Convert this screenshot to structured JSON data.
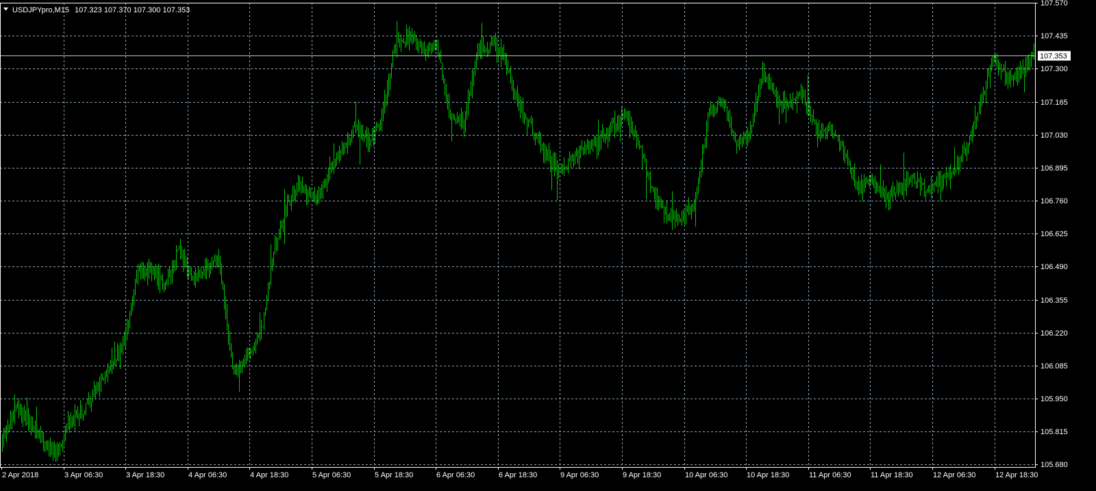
{
  "header": {
    "symbol": "USDJPYpro,M15",
    "ohlc": "107.323 107.370 107.300 107.353"
  },
  "colors": {
    "background": "#000000",
    "grid": "#8fa6b8",
    "bars": "#00c800",
    "axis_text": "#ffffff",
    "bid_line": "#c0c0c0"
  },
  "current_price": {
    "label": "107.353",
    "value": 107.353
  },
  "chart_data": {
    "type": "ohlc-bar",
    "symbol": "USDJPYpro",
    "timeframe": "M15",
    "ylim": [
      105.67,
      107.57
    ],
    "y_ticks": [
      107.57,
      107.435,
      107.3,
      107.165,
      107.03,
      106.895,
      106.76,
      106.625,
      106.49,
      106.355,
      106.22,
      106.085,
      105.95,
      105.815,
      105.68
    ],
    "y_tick_labels": [
      "107.570",
      "107.435",
      "107.300",
      "107.165",
      "107.030",
      "106.895",
      "106.760",
      "106.625",
      "106.490",
      "106.355",
      "106.220",
      "106.085",
      "105.950",
      "105.815",
      "105.680"
    ],
    "x_tick_labels": [
      "2 Apr 2018",
      "3 Apr 06:30",
      "3 Apr 18:30",
      "4 Apr 06:30",
      "4 Apr 18:30",
      "5 Apr 06:30",
      "5 Apr 18:30",
      "6 Apr 06:30",
      "6 Apr 18:30",
      "9 Apr 06:30",
      "9 Apr 18:30",
      "10 Apr 06:30",
      "10 Apr 18:30",
      "11 Apr 06:30",
      "11 Apr 18:30",
      "12 Apr 06:30",
      "12 Apr 18:30"
    ],
    "grid": true,
    "price_path": {
      "x": [
        "2 Apr 2018",
        "2 Apr 2018",
        "2 Apr 2018",
        "2 Apr 2018",
        "2 Apr 2018",
        "2 Apr 2018",
        "3 Apr 06:30",
        "3 Apr 06:30",
        "3 Apr 06:30",
        "3 Apr 06:30",
        "3 Apr 18:30",
        "3 Apr 18:30",
        "3 Apr 18:30",
        "3 Apr 18:30",
        "4 Apr 06:30",
        "4 Apr 06:30",
        "4 Apr 06:30",
        "4 Apr 06:30",
        "4 Apr 06:30",
        "4 Apr 06:30",
        "4 Apr 18:30",
        "4 Apr 18:30",
        "4 Apr 18:30",
        "4 Apr 18:30",
        "4 Apr 18:30",
        "5 Apr 06:30",
        "5 Apr 06:30",
        "5 Apr 06:30",
        "5 Apr 06:30",
        "5 Apr 06:30",
        "5 Apr 18:30",
        "5 Apr 18:30",
        "5 Apr 18:30",
        "5 Apr 18:30",
        "6 Apr 06:30",
        "6 Apr 06:30",
        "6 Apr 06:30",
        "6 Apr 06:30",
        "6 Apr 06:30",
        "6 Apr 18:30",
        "6 Apr 18:30",
        "6 Apr 18:30",
        "6 Apr 18:30",
        "9 Apr 06:30",
        "9 Apr 06:30",
        "9 Apr 06:30",
        "9 Apr 06:30",
        "9 Apr 06:30",
        "9 Apr 18:30",
        "9 Apr 18:30",
        "9 Apr 18:30",
        "9 Apr 18:30",
        "10 Apr 06:30",
        "10 Apr 06:30",
        "10 Apr 06:30",
        "10 Apr 06:30",
        "10 Apr 06:30",
        "10 Apr 18:30",
        "10 Apr 18:30",
        "10 Apr 18:30",
        "10 Apr 18:30",
        "11 Apr 06:30",
        "11 Apr 06:30",
        "11 Apr 06:30",
        "11 Apr 06:30",
        "11 Apr 06:30",
        "11 Apr 18:30",
        "11 Apr 18:30",
        "11 Apr 18:30",
        "11 Apr 18:30",
        "12 Apr 06:30",
        "12 Apr 06:30",
        "12 Apr 06:30",
        "12 Apr 06:30",
        "12 Apr 18:30",
        "12 Apr 18:30",
        "12 Apr 18:30"
      ],
      "y": [
        105.78,
        105.92,
        105.86,
        105.78,
        105.72,
        105.87,
        105.9,
        106.0,
        106.08,
        106.2,
        106.48,
        106.47,
        106.42,
        106.57,
        106.45,
        106.48,
        106.52,
        106.05,
        106.12,
        106.2,
        106.55,
        106.75,
        106.83,
        106.76,
        106.87,
        106.97,
        107.06,
        107.0,
        107.1,
        107.42,
        107.42,
        107.38,
        107.4,
        107.1,
        107.08,
        107.38,
        107.4,
        107.35,
        107.15,
        107.05,
        106.95,
        106.88,
        106.92,
        106.97,
        107.0,
        107.08,
        107.1,
        106.98,
        106.78,
        106.7,
        106.68,
        106.75,
        107.1,
        107.18,
        107.0,
        107.02,
        107.3,
        107.17,
        107.15,
        107.2,
        107.04,
        107.05,
        106.96,
        106.82,
        106.85,
        106.78,
        106.8,
        106.86,
        106.8,
        106.85,
        106.86,
        106.98,
        107.15,
        107.35,
        107.25,
        107.28,
        107.353
      ]
    }
  }
}
